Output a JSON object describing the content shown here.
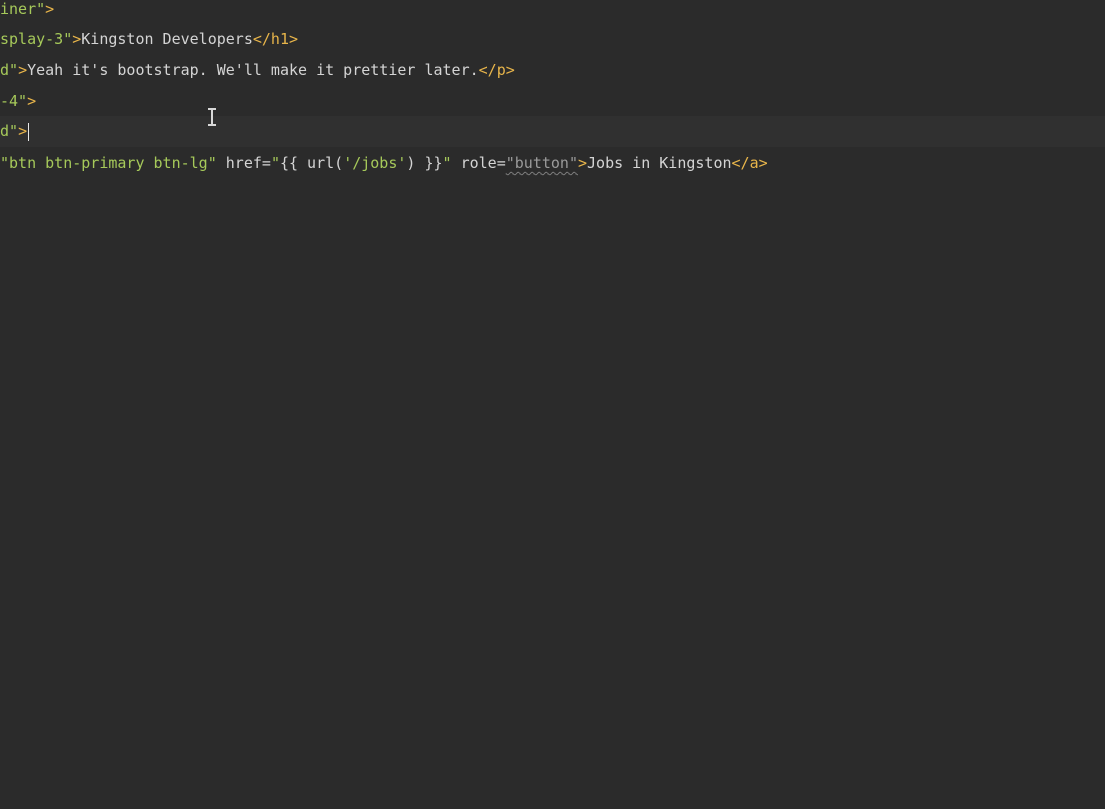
{
  "editor": {
    "lines": [
      {
        "str_tail": "iner\"",
        "close": ">"
      },
      {
        "str_tail": "splay-3\"",
        "close": ">",
        "text": "Kingston Developers",
        "end_tag": "</h1>"
      },
      {
        "str_tail": "d\"",
        "close": ">",
        "text": "Yeah it's bootstrap. We'll make it prettier later.",
        "end_tag": "</p>"
      },
      {
        "str_tail": "-4\"",
        "close": ">"
      },
      {
        "str_tail": "d\"",
        "close": ">"
      },
      {
        "class_str": "\"btn btn-primary btn-lg\"",
        "href_attr": " href=",
        "href_q1": "\"",
        "blade_open": "{{ url(",
        "url_arg": "'/jobs'",
        "blade_close": ") }}",
        "href_q2": "\"",
        "role_attr": " role=",
        "role_val": "\"button\"",
        "close": ">",
        "text": "Jobs in Kingston",
        "end_tag": "</a>"
      }
    ]
  }
}
